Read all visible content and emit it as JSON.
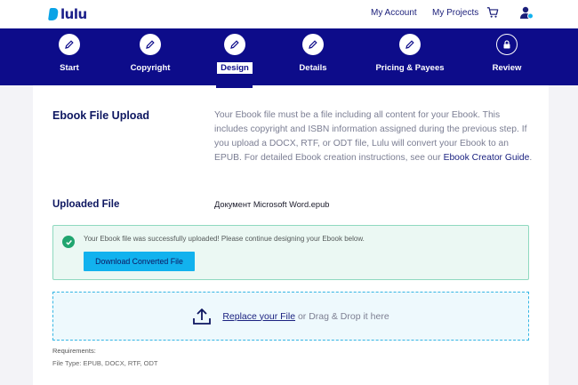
{
  "header": {
    "logo_text": "lulu",
    "links": [
      "My Account",
      "My Projects"
    ],
    "cart_icon": "cart-icon",
    "account_icon": "account-icon"
  },
  "steps": [
    {
      "label": "Start",
      "icon": "pencil-icon",
      "state": "complete"
    },
    {
      "label": "Copyright",
      "icon": "pencil-icon",
      "state": "complete"
    },
    {
      "label": "Design",
      "icon": "pencil-icon",
      "state": "active"
    },
    {
      "label": "Details",
      "icon": "pencil-icon",
      "state": "complete"
    },
    {
      "label": "Pricing & Payees",
      "icon": "pencil-icon",
      "state": "complete"
    },
    {
      "label": "Review",
      "icon": "lock-icon",
      "state": "locked"
    }
  ],
  "ebook_upload": {
    "title": "Ebook File Upload",
    "description": "Your Ebook file must be a file including all content for your Ebook. This includes copyright and ISBN information assigned during the previous step. If you upload a DOCX, RTF, or ODT file, Lulu will convert your Ebook to an EPUB. For detailed Ebook creation instructions, see our",
    "guide_link": "Ebook Creator Guide",
    "period": "."
  },
  "uploaded": {
    "title": "Uploaded File",
    "filename": "Документ Microsoft Word.epub",
    "success_message": "Your Ebook file was successfully uploaded! Please continue designing your Ebook below.",
    "download_button": "Download Converted File"
  },
  "dropzone": {
    "link_text": "Replace your File",
    "rest_text": " or Drag & Drop it here"
  },
  "requirements": {
    "title": "Requirements:",
    "file_types": "File Type: EPUB, DOCX, RTF, ODT"
  },
  "colors": {
    "nav_bg": "#0d0c8a",
    "accent": "#12b2ee",
    "success": "#20a56f"
  }
}
